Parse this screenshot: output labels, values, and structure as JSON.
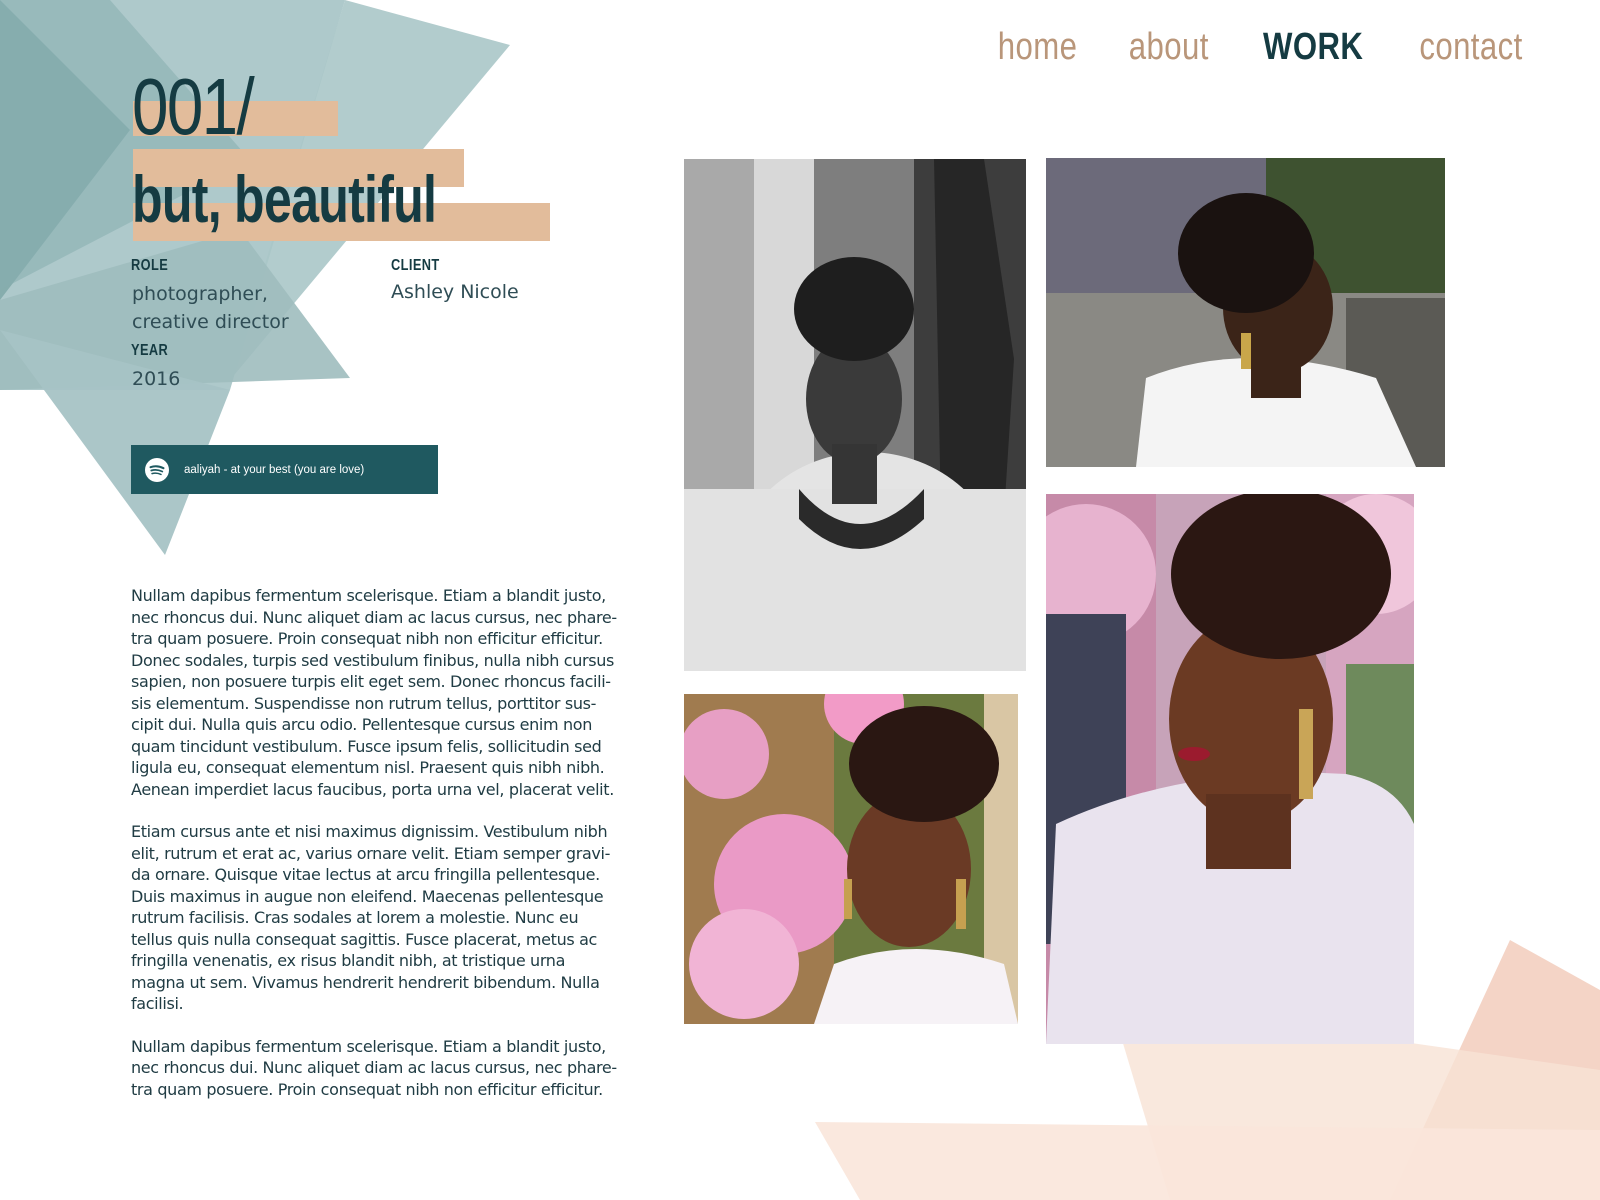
{
  "nav": {
    "items": [
      {
        "label": "home",
        "active": false
      },
      {
        "label": "about",
        "active": false
      },
      {
        "label": "WORK",
        "active": true
      },
      {
        "label": "contact",
        "active": false
      }
    ]
  },
  "project": {
    "number": "001/",
    "title": "but, beautiful",
    "role_label": "ROLE",
    "role_line1": "photographer,",
    "role_line2": "creative director",
    "client_label": "CLIENT",
    "client_value": "Ashley Nicole",
    "year_label": "YEAR",
    "year_value": "2016"
  },
  "player": {
    "icon": "spotify-icon",
    "track": "aaliyah - at your best (you are love)"
  },
  "body": {
    "paragraphs": [
      "Nullam dapibus fermentum scelerisque. Etiam a blandit justo, nec rhoncus dui. Nunc aliquet diam ac lacus cursus, nec phare-tra quam posuere. Proin consequat nibh non efficitur efficitur. Donec sodales, turpis sed vestibulum finibus, nulla nibh cursus sapien, non posuere turpis elit eget sem. Donec rhoncus facili-sis elementum. Suspendisse non rutrum tellus, porttitor sus-cipit dui. Nulla quis arcu odio. Pellentesque cursus enim non quam tincidunt vestibulum. Fusce ipsum felis, sollicitudin sed ligula eu, consequat elementum nisl. Praesent quis nibh nibh. Aenean imperdiet lacus faucibus, porta urna vel, placerat velit.",
      "Etiam cursus ante et nisi maximus dignissim. Vestibulum nibh elit, rutrum et erat ac, varius ornare velit. Etiam semper gravi-da ornare. Quisque vitae lectus at arcu fringilla pellentesque. Duis maximus in augue non eleifend. Maecenas pellentesque rutrum facilisis. Cras sodales at lorem a molestie. Nunc eu tellus quis nulla consequat sagittis. Fusce placerat, metus ac fringilla venenatis, ex risus blandit nibh, at tristique urna magna ut sem. Vivamus hendrerit hendrerit bibendum. Nulla facilisi.",
      "Nullam dapibus fermentum scelerisque. Etiam a blandit justo, nec rhoncus dui. Nunc aliquet diam ac lacus cursus, nec phare-tra quam posuere. Proin consequat nibh non efficitur efficitur."
    ]
  },
  "colors": {
    "accent_dark": "#153b42",
    "nav_inactive": "#b9967a",
    "highlight": "#e2bc9b",
    "teal": "#1f5960"
  }
}
